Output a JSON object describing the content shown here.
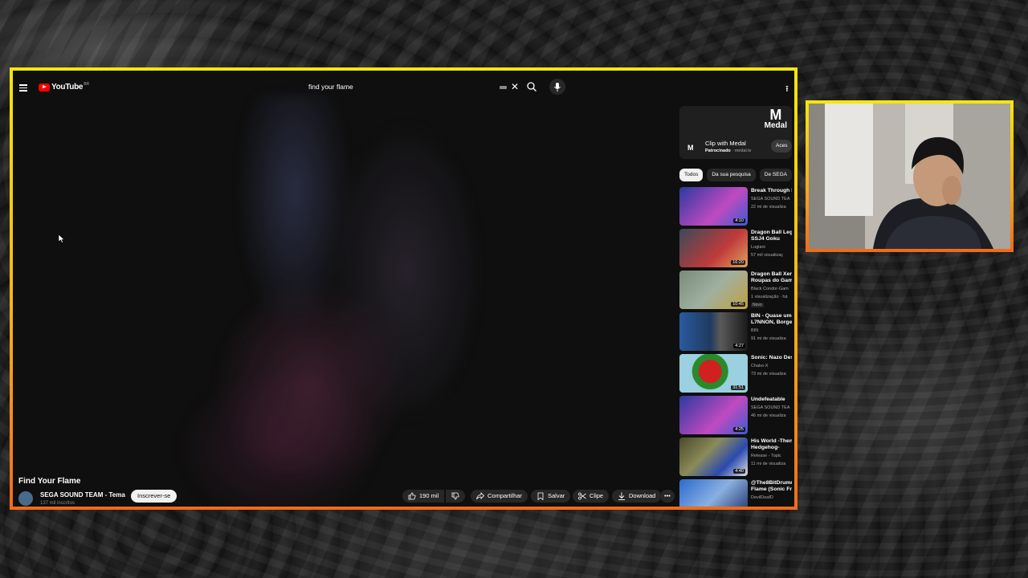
{
  "app": {
    "logo_text": "YouTube",
    "logo_country": "BR"
  },
  "search": {
    "query": "find your flame"
  },
  "video": {
    "title": "Find Your Flame",
    "channel": "SEGA SOUND TEAM - Tema",
    "subscribers": "137 mil inscritos",
    "subscribe_label": "Inscrever-se",
    "likes": "190 mil",
    "share_label": "Compartilhar",
    "save_label": "Salvar",
    "clip_label": "Clipe",
    "download_label": "Download"
  },
  "ad": {
    "brand": "Medal",
    "title": "Clip with Medal",
    "sponsored": "Patrocinado",
    "domain": "medal.tv",
    "cta": "Aces"
  },
  "chips": [
    "Todos",
    "Da sua pesquisa",
    "De SEGA"
  ],
  "recommendations": [
    {
      "title": "Break Through I",
      "channel": "SEGA SOUND TEA",
      "meta": "22 mi de visualiza",
      "duration": "4:10",
      "thumb": "#6a52c8"
    },
    {
      "title": "Dragon Ball Leg SSJ4 Goku",
      "channel": "Lugiani",
      "meta": "57 mil visualizaç",
      "duration": "16:20",
      "thumb": "#8a3a4a"
    },
    {
      "title": "Dragon Ball Xen Roupas do Gam",
      "channel": "Black Condor-Gam",
      "meta": "1 visualização · há",
      "badge": "Novo",
      "duration": "10:45",
      "thumb": "#6d7a6a"
    },
    {
      "title": "BIN - Quase um L7NNON, Borge",
      "channel": "BIN",
      "meta": "91 mi de visualiza",
      "duration": "4:27",
      "thumb": "#3a4a7a"
    },
    {
      "title": "Sonic: Nazo Des",
      "channel": "Chako-X",
      "meta": "73 mi de visualiza",
      "duration": "31:51",
      "thumb": "#c43030"
    },
    {
      "title": "Undefeatable",
      "channel": "SEGA SOUND TEA",
      "meta": "46 mi de visualiza",
      "duration": "4:25",
      "thumb": "#5a4ac0"
    },
    {
      "title": "His World -Then Hedgehog-",
      "channel": "Release - Topic",
      "meta": "11 mi de visualiza",
      "duration": "4:40",
      "thumb": "#6a6a3a"
    },
    {
      "title": "@The8BitDrumr Flame (Sonic Fr",
      "channel": "DevilDeafD",
      "meta": "",
      "duration": "",
      "thumb": "#3a5a9a"
    }
  ]
}
